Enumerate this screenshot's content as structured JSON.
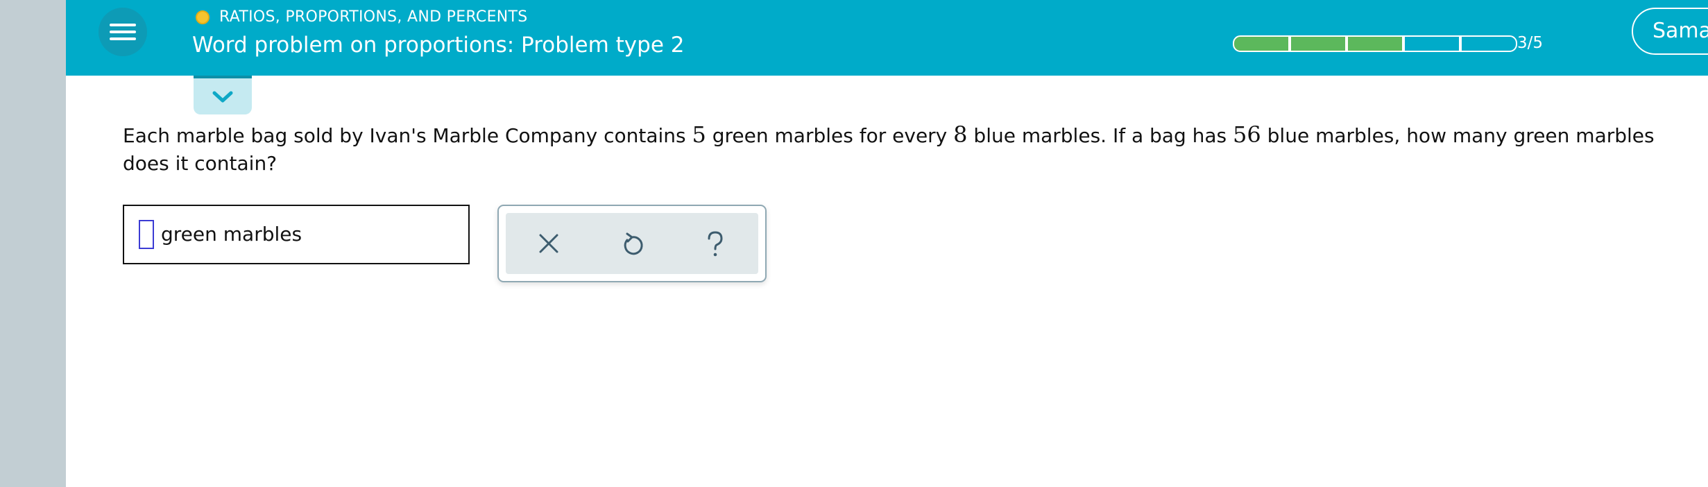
{
  "header": {
    "topic": "RATIOS, PROPORTIONS, AND PERCENTS",
    "title": "Word problem on proportions: Problem type 2",
    "progress": {
      "completed": 3,
      "total": 5,
      "label": "3/5"
    },
    "user_name": "Sama"
  },
  "question": {
    "part1": "Each marble bag sold by Ivan's Marble Company contains ",
    "num1": "5",
    "part2": " green marbles for every ",
    "num2": "8",
    "part3": " blue marbles. If a bag has ",
    "num3": "56",
    "part4": " blue marbles, how many green marbles does it contain?"
  },
  "answer": {
    "value": "",
    "unit": "green marbles"
  },
  "tools": [
    {
      "name": "clear",
      "icon": "close-icon"
    },
    {
      "name": "undo",
      "icon": "undo-icon"
    },
    {
      "name": "help",
      "icon": "help-icon"
    }
  ],
  "colors": {
    "header_bg": "#00abc9",
    "rail_bg": "#c2ced3",
    "progress_done": "#5cb85c",
    "topic_dot": "#f5c42f",
    "input_cursor": "#3b3bd4"
  },
  "icons": {
    "menu": "hamburger-icon",
    "collapse": "chevron-down-icon"
  }
}
